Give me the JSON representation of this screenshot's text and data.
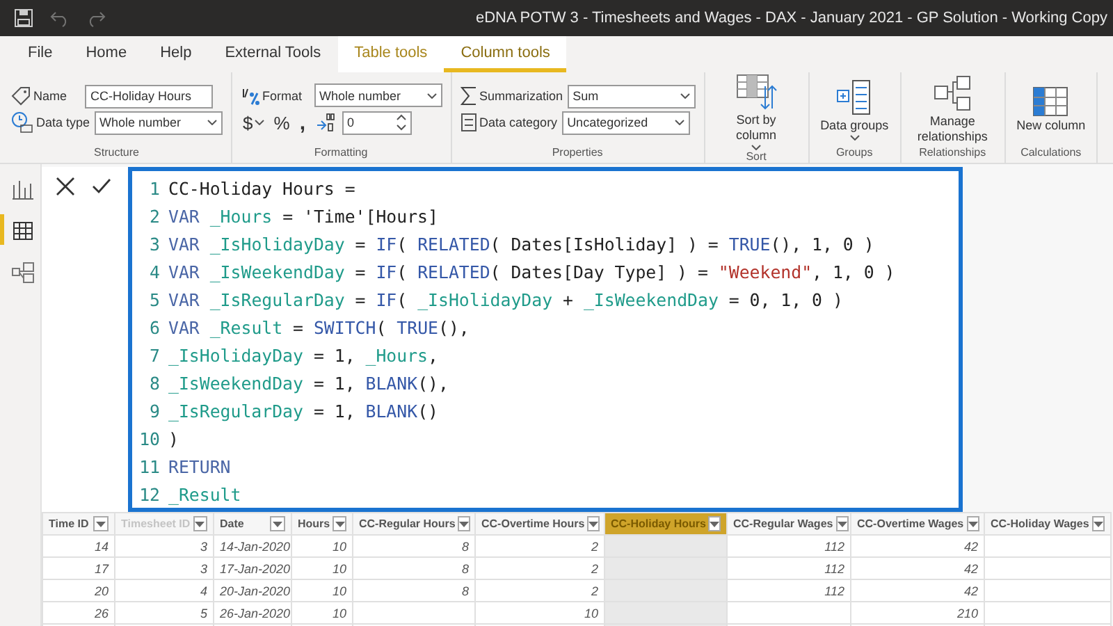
{
  "window": {
    "title": "eDNA POTW 3 - Timesheets and Wages - DAX - January 2021 - GP Solution - Working Copy",
    "quick_access": [
      {
        "kind": "save",
        "disabled": false
      },
      {
        "kind": "undo",
        "disabled": true
      },
      {
        "kind": "redo",
        "disabled": true
      }
    ]
  },
  "tabs": [
    {
      "label": "File",
      "kind": "normal",
      "selected": false
    },
    {
      "label": "Home",
      "kind": "normal",
      "selected": false
    },
    {
      "label": "Help",
      "kind": "normal",
      "selected": false
    },
    {
      "label": "External Tools",
      "kind": "normal",
      "selected": false
    },
    {
      "label": "Table tools",
      "kind": "contextual",
      "selected": false
    },
    {
      "label": "Column tools",
      "kind": "contextual",
      "selected": true
    }
  ],
  "ribbon": {
    "groups": [
      {
        "label": "Structure",
        "kind": "fields",
        "fields": [
          {
            "label": "Name",
            "value": "CC-Holiday Hours",
            "kind": "text"
          },
          {
            "label": "Data type",
            "value": "Whole number",
            "kind": "select"
          }
        ]
      },
      {
        "label": "Formatting",
        "kind": "format",
        "format_label": "Format",
        "format_value": "Whole number",
        "currency": "$",
        "percent": "%",
        "comma": ",",
        "decimals": "0"
      },
      {
        "label": "Properties",
        "kind": "fields",
        "fields": [
          {
            "label": "Summarization",
            "value": "Sum",
            "kind": "select"
          },
          {
            "label": "Data category",
            "value": "Uncategorized",
            "kind": "select"
          }
        ]
      },
      {
        "label": "Sort",
        "kind": "big",
        "button": {
          "label": "Sort by column",
          "dropdown": true
        }
      },
      {
        "label": "Groups",
        "kind": "big",
        "button": {
          "label": "Data groups",
          "dropdown": true
        }
      },
      {
        "label": "Relationships",
        "kind": "big",
        "button": {
          "label": "Manage relationships",
          "dropdown": false
        }
      },
      {
        "label": "Calculations",
        "kind": "big",
        "button": {
          "label": "New column",
          "dropdown": false
        }
      }
    ]
  },
  "sidebar": {
    "items": [
      {
        "kind": "report",
        "selected": false
      },
      {
        "kind": "data",
        "selected": true
      },
      {
        "kind": "model",
        "selected": false
      }
    ]
  },
  "formula": {
    "lines": [
      {
        "num": "1",
        "tokens": [
          {
            "kind": "plain",
            "text": "CC-Holiday Hours ="
          }
        ]
      },
      {
        "num": "2",
        "tokens": [
          {
            "kind": "kw",
            "text": "VAR"
          },
          {
            "kind": "var",
            "text": " _Hours"
          },
          {
            "kind": "plain",
            "text": " = 'Time'[Hours]"
          }
        ]
      },
      {
        "num": "3",
        "tokens": [
          {
            "kind": "kw",
            "text": "VAR"
          },
          {
            "kind": "var",
            "text": " _IsHolidayDay"
          },
          {
            "kind": "plain",
            "text": " = "
          },
          {
            "kind": "func",
            "text": "IF"
          },
          {
            "kind": "plain",
            "text": "( "
          },
          {
            "kind": "func",
            "text": "RELATED"
          },
          {
            "kind": "plain",
            "text": "( Dates[IsHoliday] ) = "
          },
          {
            "kind": "func",
            "text": "TRUE"
          },
          {
            "kind": "plain",
            "text": "(), 1, 0 )"
          }
        ]
      },
      {
        "num": "4",
        "tokens": [
          {
            "kind": "kw",
            "text": "VAR"
          },
          {
            "kind": "var",
            "text": " _IsWeekendDay"
          },
          {
            "kind": "plain",
            "text": " = "
          },
          {
            "kind": "func",
            "text": "IF"
          },
          {
            "kind": "plain",
            "text": "( "
          },
          {
            "kind": "func",
            "text": "RELATED"
          },
          {
            "kind": "plain",
            "text": "( Dates[Day Type] ) = "
          },
          {
            "kind": "str",
            "text": "\"Weekend\""
          },
          {
            "kind": "plain",
            "text": ", 1, 0 )"
          }
        ]
      },
      {
        "num": "5",
        "tokens": [
          {
            "kind": "kw",
            "text": "VAR"
          },
          {
            "kind": "var",
            "text": " _IsRegularDay"
          },
          {
            "kind": "plain",
            "text": " = "
          },
          {
            "kind": "func",
            "text": "IF"
          },
          {
            "kind": "plain",
            "text": "( "
          },
          {
            "kind": "var",
            "text": "_IsHolidayDay"
          },
          {
            "kind": "plain",
            "text": " + "
          },
          {
            "kind": "var",
            "text": "_IsWeekendDay"
          },
          {
            "kind": "plain",
            "text": " = 0, 1, 0 )"
          }
        ]
      },
      {
        "num": "6",
        "tokens": [
          {
            "kind": "kw",
            "text": "VAR"
          },
          {
            "kind": "var",
            "text": " _Result"
          },
          {
            "kind": "plain",
            "text": " = "
          },
          {
            "kind": "func",
            "text": "SWITCH"
          },
          {
            "kind": "plain",
            "text": "( "
          },
          {
            "kind": "func",
            "text": "TRUE"
          },
          {
            "kind": "plain",
            "text": "(),"
          }
        ]
      },
      {
        "num": "7",
        "tokens": [
          {
            "kind": "var",
            "text": "_IsHolidayDay"
          },
          {
            "kind": "plain",
            "text": " = 1, "
          },
          {
            "kind": "var",
            "text": "_Hours"
          },
          {
            "kind": "plain",
            "text": ","
          }
        ]
      },
      {
        "num": "8",
        "tokens": [
          {
            "kind": "var",
            "text": "_IsWeekendDay"
          },
          {
            "kind": "plain",
            "text": " = 1, "
          },
          {
            "kind": "func",
            "text": "BLANK"
          },
          {
            "kind": "plain",
            "text": "(),"
          }
        ]
      },
      {
        "num": "9",
        "tokens": [
          {
            "kind": "var",
            "text": "_IsRegularDay"
          },
          {
            "kind": "plain",
            "text": " = 1, "
          },
          {
            "kind": "func",
            "text": "BLANK"
          },
          {
            "kind": "plain",
            "text": "()"
          }
        ]
      },
      {
        "num": "10",
        "tokens": [
          {
            "kind": "plain",
            "text": ")"
          }
        ]
      },
      {
        "num": "11",
        "tokens": [
          {
            "kind": "kw",
            "text": "RETURN"
          }
        ]
      },
      {
        "num": "12",
        "tokens": [
          {
            "kind": "var",
            "text": "_Result"
          }
        ]
      }
    ]
  },
  "table": {
    "columns": [
      {
        "label": "Time ID",
        "hidden": false,
        "selected": false
      },
      {
        "label": "Timesheet ID",
        "hidden": true,
        "selected": false
      },
      {
        "label": "Date",
        "hidden": false,
        "selected": false
      },
      {
        "label": "Hours",
        "hidden": false,
        "selected": false
      },
      {
        "label": "CC-Regular Hours",
        "hidden": false,
        "selected": false
      },
      {
        "label": "CC-Overtime Hours",
        "hidden": false,
        "selected": false
      },
      {
        "label": "CC-Holiday Hours",
        "hidden": false,
        "selected": true
      },
      {
        "label": "CC-Regular Wages",
        "hidden": false,
        "selected": false
      },
      {
        "label": "CC-Overtime Wages",
        "hidden": false,
        "selected": false
      },
      {
        "label": "CC-Holiday Wages",
        "hidden": false,
        "selected": false
      }
    ],
    "rows": [
      [
        "14",
        "3",
        "14-Jan-2020",
        "10",
        "8",
        "2",
        null,
        "112",
        "42",
        null
      ],
      [
        "17",
        "3",
        "17-Jan-2020",
        "10",
        "8",
        "2",
        null,
        "112",
        "42",
        null
      ],
      [
        "20",
        "4",
        "20-Jan-2020",
        "10",
        "8",
        "2",
        null,
        "112",
        "42",
        null
      ],
      [
        "26",
        "5",
        "26-Jan-2020",
        "10",
        null,
        "10",
        null,
        null,
        "210",
        null
      ]
    ]
  }
}
